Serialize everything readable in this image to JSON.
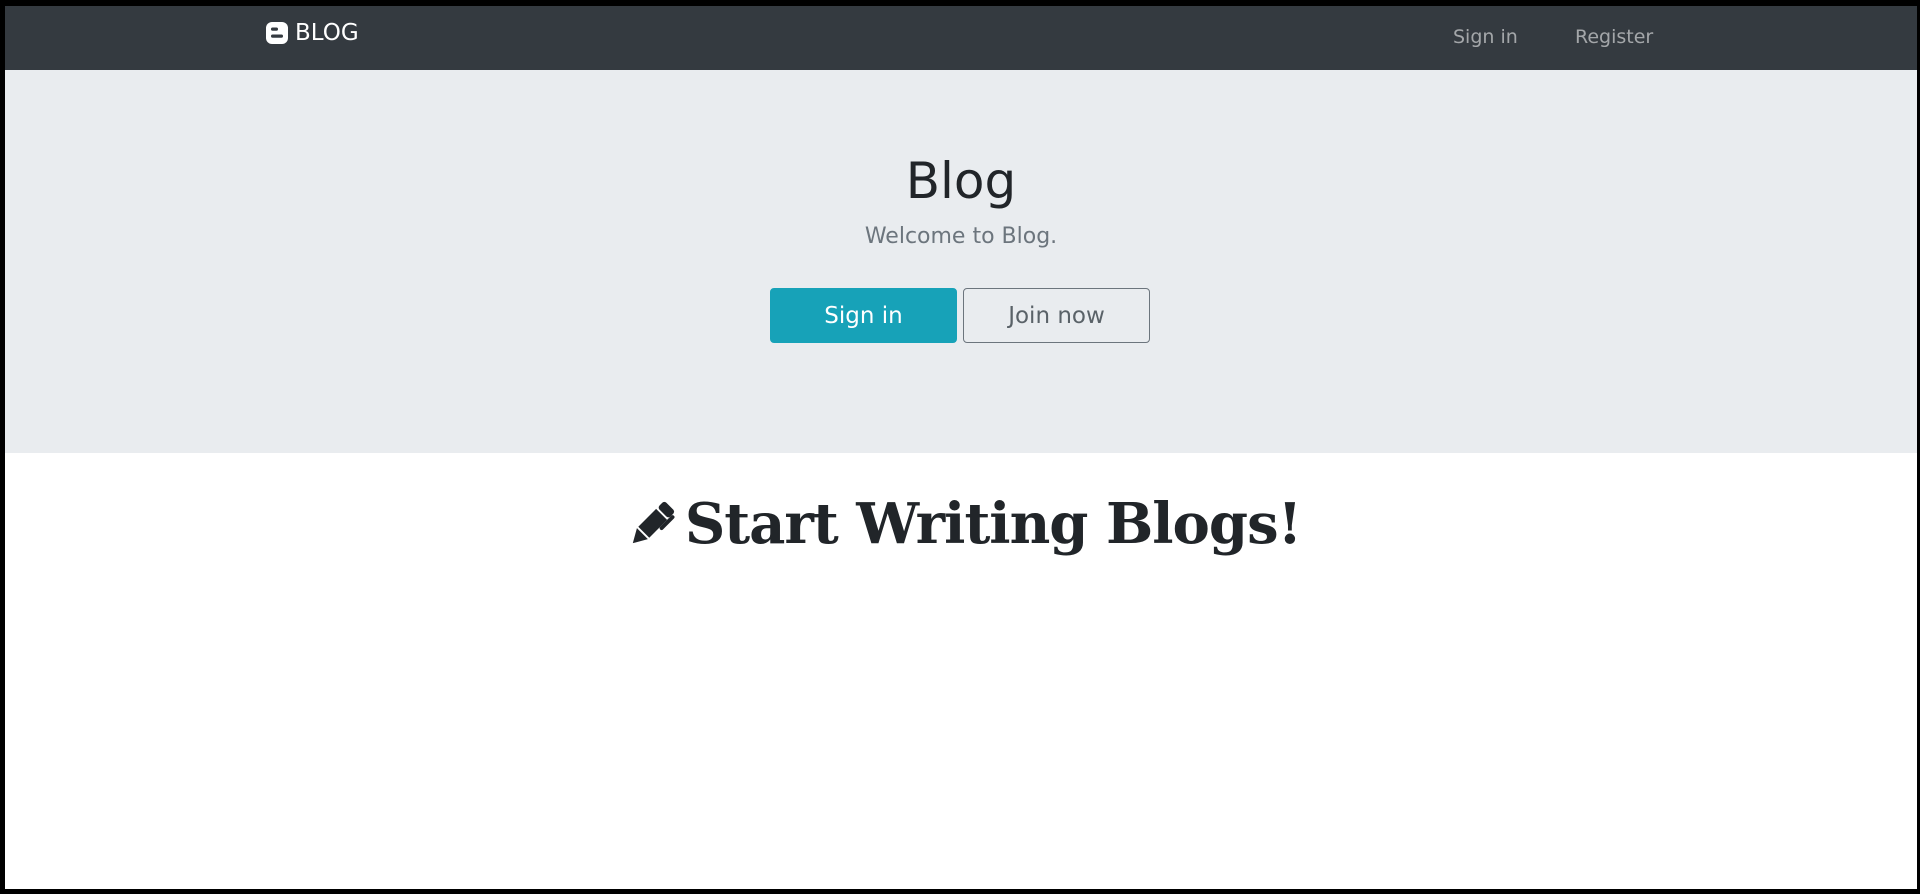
{
  "navbar": {
    "brand_label": "BLOG",
    "brand_icon": "blogger-icon",
    "links": {
      "signin": "Sign in",
      "register": "Register"
    }
  },
  "hero": {
    "title": "Blog",
    "subtitle": "Welcome to Blog.",
    "signin_button": "Sign in",
    "join_button": "Join now"
  },
  "main": {
    "heading": "Start Writing Blogs!",
    "heading_icon": "pencil-icon"
  },
  "colors": {
    "navbar_bg": "#343a40",
    "hero_bg": "#e9ecef",
    "primary_button": "#17a2b8",
    "text_dark": "#212529",
    "text_muted": "#6c757d"
  }
}
